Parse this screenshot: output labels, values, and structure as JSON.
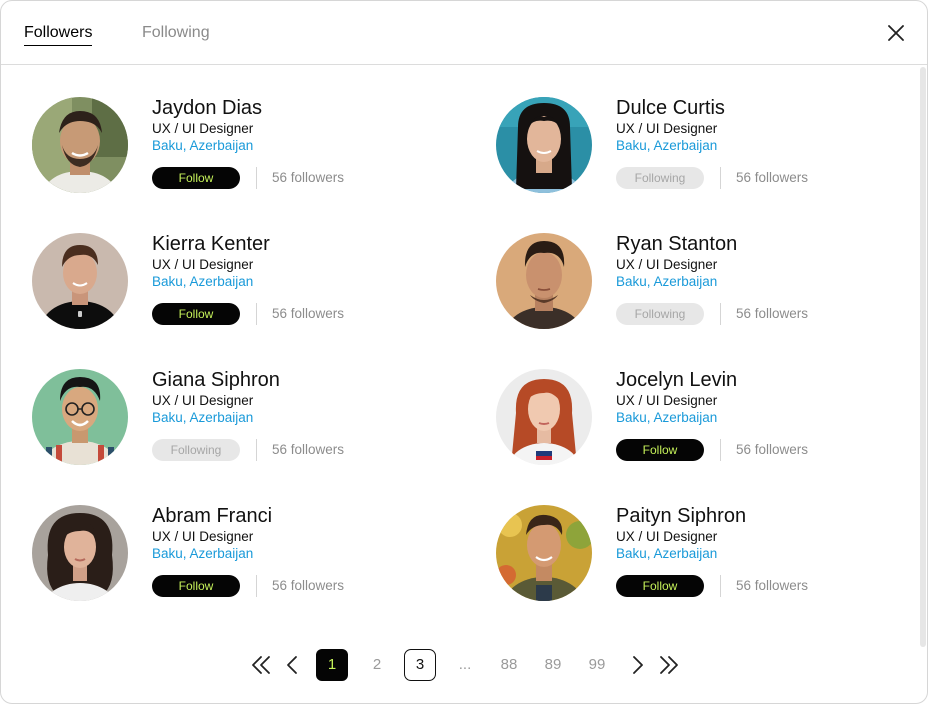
{
  "tabs": {
    "followers": "Followers",
    "following": "Following"
  },
  "icons": {
    "close": "close-icon",
    "first": "double-chevron-left-icon",
    "prev": "chevron-left-icon",
    "next": "chevron-right-icon",
    "last": "double-chevron-right-icon"
  },
  "colors": {
    "accent_text": "#c6f25a",
    "location_link": "#1a9ad9",
    "follow_button": "#050505",
    "following_button": "#e7e7e7"
  },
  "users": [
    {
      "name": "Jaydon Dias",
      "role": "UX / UI Designer",
      "location": "Baku, Azerbaijan",
      "button": "Follow",
      "followers": "56 followers"
    },
    {
      "name": "Dulce Curtis",
      "role": "UX / UI Designer",
      "location": "Baku, Azerbaijan",
      "button": "Following",
      "followers": "56 followers"
    },
    {
      "name": "Kierra Kenter",
      "role": "UX / UI Designer",
      "location": "Baku, Azerbaijan",
      "button": "Follow",
      "followers": "56 followers"
    },
    {
      "name": "Ryan Stanton",
      "role": "UX / UI Designer",
      "location": "Baku, Azerbaijan",
      "button": "Following",
      "followers": "56 followers"
    },
    {
      "name": "Giana Siphron",
      "role": "UX / UI Designer",
      "location": "Baku, Azerbaijan",
      "button": "Following",
      "followers": "56 followers"
    },
    {
      "name": "Jocelyn Levin",
      "role": "UX / UI Designer",
      "location": "Baku, Azerbaijan",
      "button": "Follow",
      "followers": "56 followers"
    },
    {
      "name": "Abram Franci",
      "role": "UX / UI Designer",
      "location": "Baku, Azerbaijan",
      "button": "Follow",
      "followers": "56 followers"
    },
    {
      "name": "Paityn Siphron",
      "role": "UX / UI Designer",
      "location": "Baku, Azerbaijan",
      "button": "Follow",
      "followers": "56 followers"
    }
  ],
  "pagination": {
    "pages": [
      "1",
      "2",
      "3",
      "...",
      "88",
      "89",
      "99"
    ],
    "current": "1",
    "outlined": "3"
  }
}
